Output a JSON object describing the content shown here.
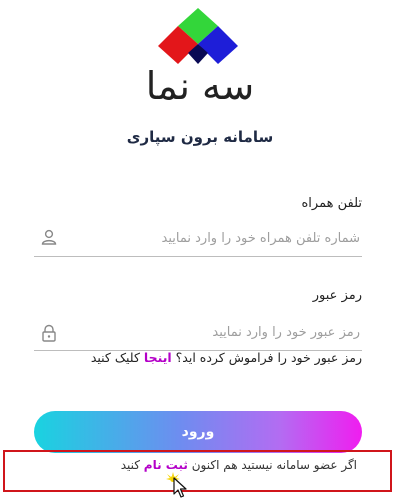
{
  "brand": {
    "name": "سه نما",
    "subtitle": "سامانه برون سپاری"
  },
  "form": {
    "phone": {
      "label": "تلفن همراه",
      "placeholder": "شماره تلفن همراه خود را وارد نمایید",
      "value": ""
    },
    "password": {
      "label": "رمز عبور",
      "placeholder": "رمز عبور خود را وارد نمایید",
      "value": ""
    },
    "forgot": {
      "text": "رمز عبور خود را فراموش کرده اید؟",
      "link": "اینجا",
      "suffix": "کلیک کنید"
    },
    "submit_label": "ورود"
  },
  "register": {
    "text": "اگر عضو سامانه نیستید هم اکنون",
    "link": "ثبت نام",
    "suffix": "کنید"
  },
  "colors": {
    "accent_link": "#b400c8",
    "button_gradient": [
      "#19d3e0",
      "#f01df0"
    ],
    "highlight_border": "#d0151b",
    "logo": [
      "#2ecc2e",
      "#e01b1b",
      "#1d1ddb"
    ]
  }
}
